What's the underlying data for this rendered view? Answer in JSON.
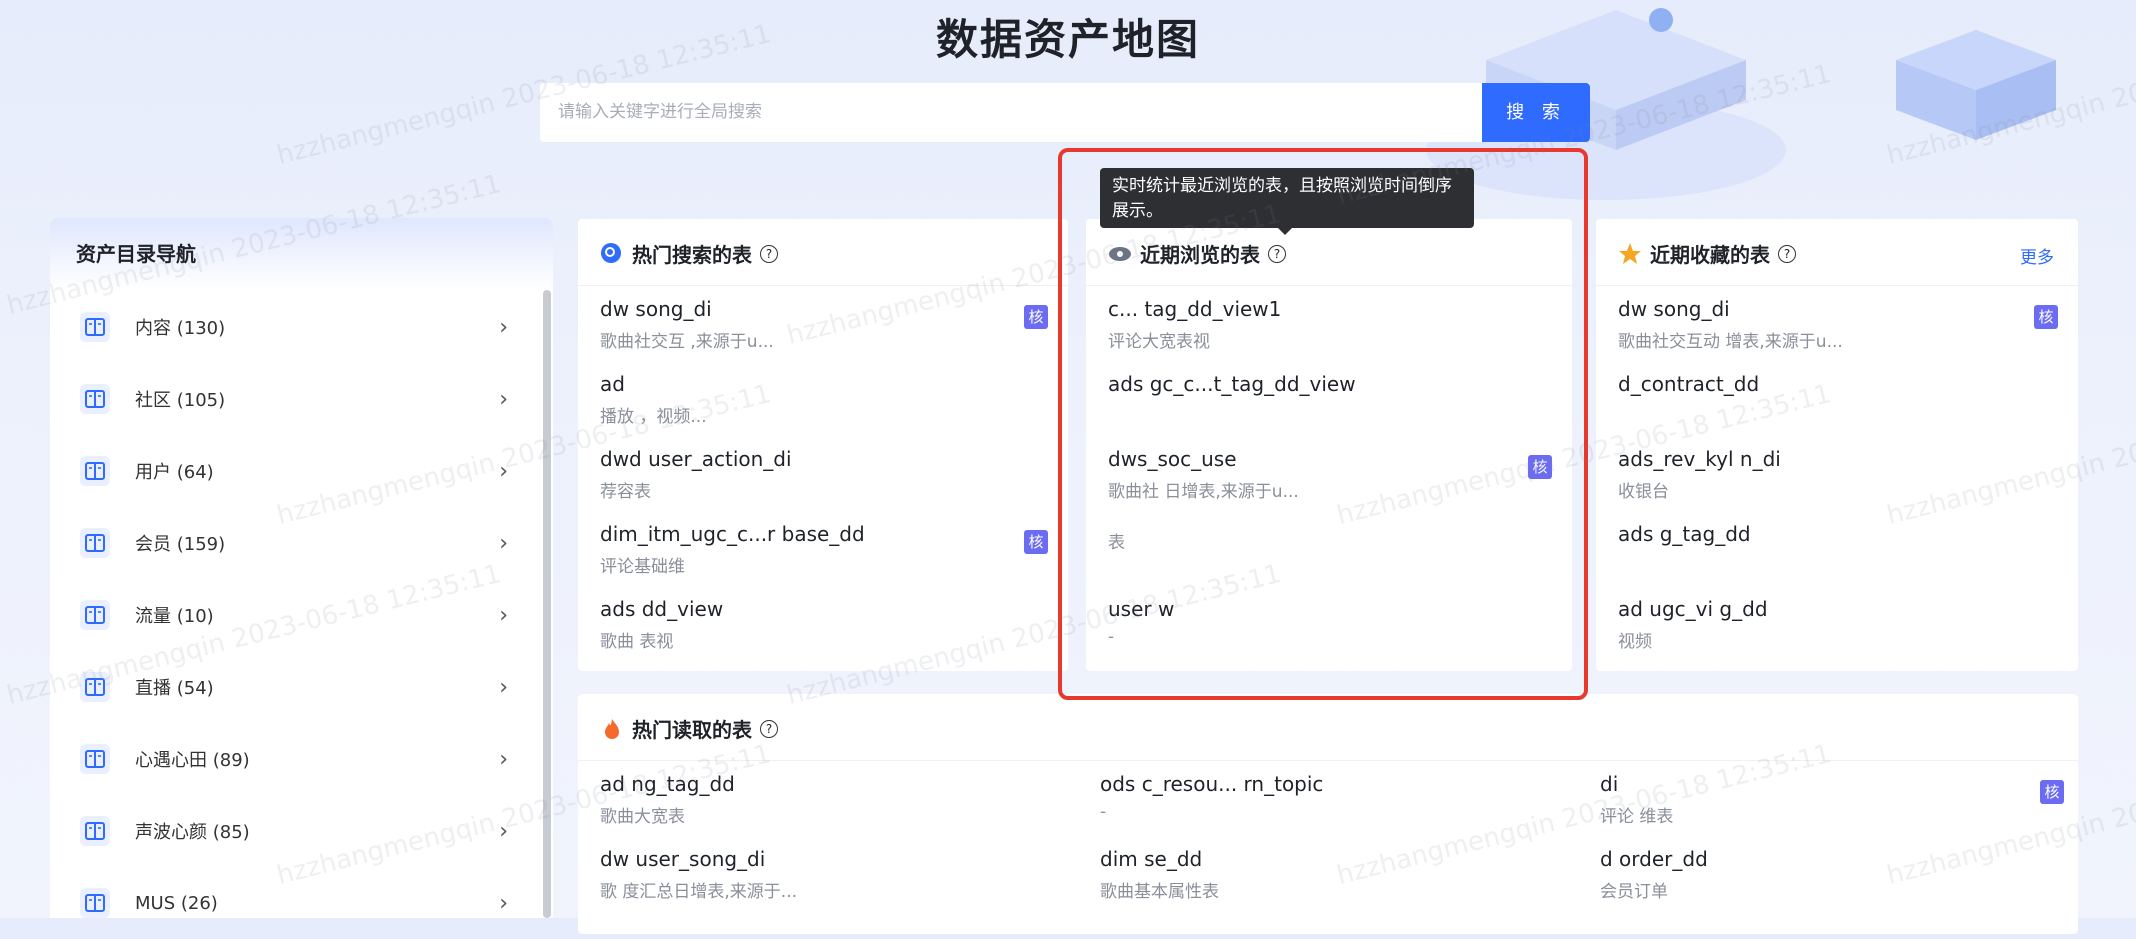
{
  "page": {
    "title": "数据资产地图"
  },
  "search": {
    "placeholder": "请输入关键字进行全局搜索",
    "button_label": "搜 索"
  },
  "sidebar": {
    "title": "资产目录导航",
    "items": [
      {
        "label": "内容 (130)"
      },
      {
        "label": "社区 (105)"
      },
      {
        "label": "用户 (64)"
      },
      {
        "label": "会员 (159)"
      },
      {
        "label": "流量 (10)"
      },
      {
        "label": "直播 (54)"
      },
      {
        "label": "心遇心田 (89)"
      },
      {
        "label": "声波心颜 (85)"
      },
      {
        "label": "MUS (26)"
      }
    ]
  },
  "tooltip": {
    "text": "实时统计最近浏览的表，且按照浏览时间倒序展示。"
  },
  "badge_label": "核",
  "hot_search": {
    "title": "热门搜索的表",
    "rows": [
      {
        "name": "dw               song_di",
        "desc": "歌曲社交互         ,来源于u..."
      },
      {
        "name": "ad",
        "desc": "播放                      ，视频..."
      },
      {
        "name": "dwd             user_action_di",
        "desc": "              荐容表"
      },
      {
        "name": "dim_itm_ugc_c...r      base_dd",
        "desc": "评论基础维"
      },
      {
        "name": "ads             dd_view",
        "desc": "歌曲          表视"
      }
    ]
  },
  "recent_browse": {
    "title": "近期浏览的表",
    "rows": [
      {
        "name": "           c... tag_dd_view1",
        "desc": "评论大宽表视"
      },
      {
        "name": "ads       gc_c...t_tag_dd_view",
        "desc": ""
      },
      {
        "name": "dws_soc_use",
        "desc": "歌曲社          日增表,来源于u..."
      },
      {
        "name": "",
        "desc": "      表"
      },
      {
        "name": "user          w",
        "desc": "-"
      }
    ]
  },
  "recent_fav": {
    "title": "近期收藏的表",
    "more": "更多",
    "rows": [
      {
        "name": "dw          song_di",
        "desc": "歌曲社交互动        增表,来源于u..."
      },
      {
        "name": "           d_contract_dd",
        "desc": ""
      },
      {
        "name": "ads_rev_kyl            n_di",
        "desc": "收银台"
      },
      {
        "name": "ads              g_tag_dd",
        "desc": ""
      },
      {
        "name": "ad      ugc_vi        g_dd",
        "desc": "视频"
      }
    ]
  },
  "hot_read": {
    "title": "热门读取的表",
    "rows": [
      {
        "name": "ad              ng_tag_dd",
        "desc": "歌曲大宽表"
      },
      {
        "name": "ods     c_resou...  rn_topic",
        "desc": "-"
      },
      {
        "name": "di",
        "desc": "评论      维表"
      },
      {
        "name": "dw      user_song_di",
        "desc": "歌          度汇总日增表,来源于..."
      },
      {
        "name": "dim              se_dd",
        "desc": "歌曲基本属性表"
      },
      {
        "name": "d            order_dd",
        "desc": "会员订单"
      }
    ]
  },
  "watermark": "hzzhangmengqin 2023-06-18 12:35:11",
  "colors": {
    "accent": "#2f6bff",
    "badge": "#6c6cf2",
    "highlight": "#e8392e"
  }
}
